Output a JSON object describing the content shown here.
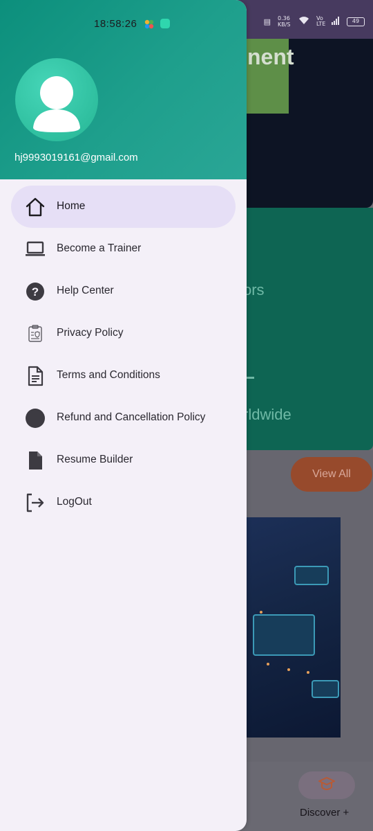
{
  "status_bar": {
    "time": "18:58:26",
    "net_speed": "0.36 KB/S",
    "signal": "Vo LTE",
    "battery": "49"
  },
  "drawer": {
    "user_email": "hj9993019161@gmail.com",
    "items": [
      {
        "label": "Home",
        "icon": "home-icon",
        "active": true
      },
      {
        "label": "Become a Trainer",
        "icon": "laptop-icon",
        "active": false
      },
      {
        "label": "Help Center",
        "icon": "help-icon",
        "active": false
      },
      {
        "label": "Privacy Policy",
        "icon": "policy-icon",
        "active": false
      },
      {
        "label": "Terms and Conditions",
        "icon": "document-icon",
        "active": false
      },
      {
        "label": "Refund and Cancellation Policy",
        "icon": "circle-icon",
        "active": false
      },
      {
        "label": "Resume Builder",
        "icon": "file-icon",
        "active": false
      },
      {
        "label": "LogOut",
        "icon": "logout-icon",
        "active": false
      }
    ]
  },
  "background": {
    "banner_text": "nent",
    "stats_text_1": "ors",
    "stats_text_2": "rldwide",
    "view_all": "View All",
    "discover_label": "Discover +"
  },
  "colors": {
    "header_teal": "#1e9f8c",
    "drawer_bg": "#f4f0f8",
    "active_item": "#e6dff6",
    "icon_dark": "#3d3b42"
  }
}
